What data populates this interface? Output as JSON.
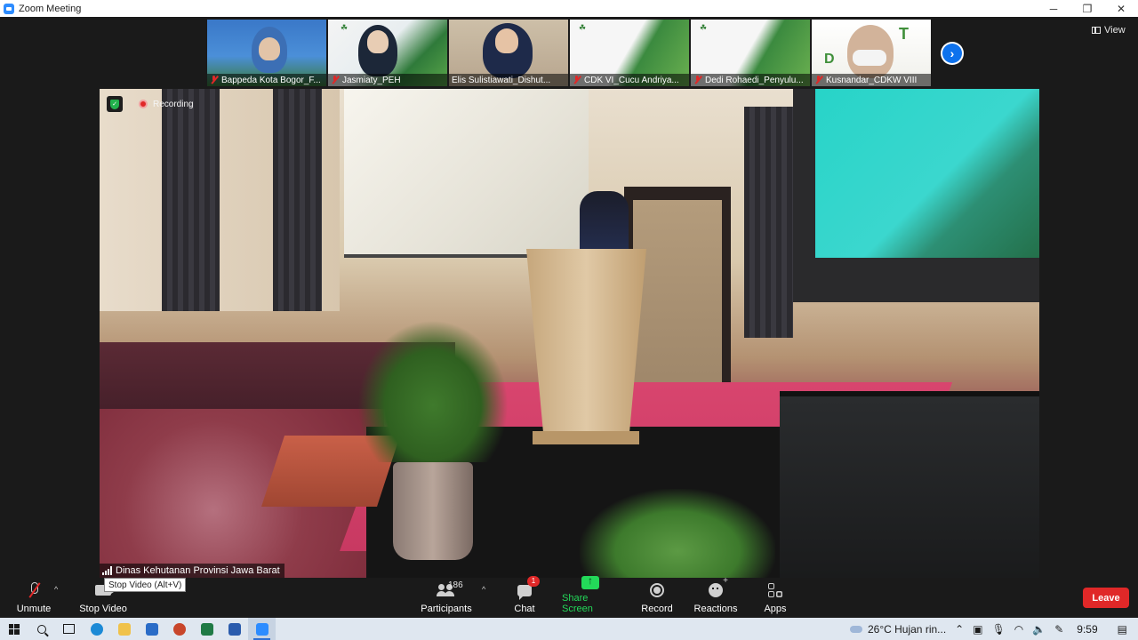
{
  "window": {
    "title": "Zoom Meeting",
    "controls": {
      "minimize": "─",
      "restore": "❐",
      "close": "✕"
    }
  },
  "view_button": {
    "label": "View"
  },
  "thumbnails": [
    {
      "name": "Bappeda Kota Bogor_F..."
    },
    {
      "name": "Jasmiaty_PEH"
    },
    {
      "name": "Elis Sulistiawati_Dishut..."
    },
    {
      "name": "CDK VI_Cucu Andriya..."
    },
    {
      "name": "Dedi Rohaedi_Penyulu..."
    },
    {
      "name": "Kusnandar_CDKW VIII"
    }
  ],
  "thumb_next": {
    "glyph": "›"
  },
  "main_video": {
    "recording_label": "Recording",
    "speaker_name": "Dinas Kehutanan Provinsi Jawa Barat"
  },
  "toolbar": {
    "unmute": "Unmute",
    "stop_video": "Stop Video",
    "tooltip": "Stop Video (Alt+V)",
    "participants": "Participants",
    "participant_count": "186",
    "chat": "Chat",
    "chat_badge": "1",
    "share_screen": "Share Screen",
    "record": "Record",
    "reactions": "Reactions",
    "apps": "Apps",
    "leave": "Leave",
    "caret": "^"
  },
  "taskbar": {
    "weather": "26°C  Hujan rin...",
    "time": "9:59"
  },
  "colors": {
    "accent_blue": "#0e72ed",
    "share_green": "#23d959",
    "leave_red": "#e02828"
  }
}
